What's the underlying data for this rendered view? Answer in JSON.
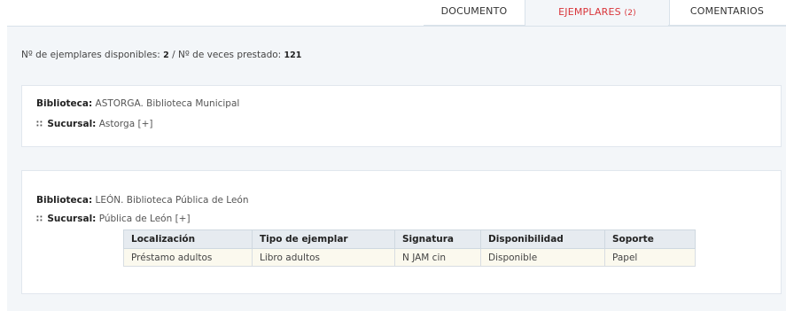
{
  "tabs": {
    "documento": "DOCUMENTO",
    "ejemplares": "EJEMPLARES",
    "ejemplares_count": "(2)",
    "comentarios": "COMENTARIOS"
  },
  "summary": {
    "disponibles_label": "Nº de ejemplares disponibles:",
    "disponibles_value": "2",
    "separator": "/",
    "prestado_label": "Nº de veces prestado:",
    "prestado_value": "121"
  },
  "libraries": [
    {
      "biblioteca_label": "Biblioteca:",
      "biblioteca_value": "ASTORGA. Biblioteca Municipal",
      "sucursal_label": "Sucursal:",
      "sucursal_value": "Astorga",
      "expand": "[+]"
    },
    {
      "biblioteca_label": "Biblioteca:",
      "biblioteca_value": "LEÓN. Biblioteca Pública de León",
      "sucursal_label": "Sucursal:",
      "sucursal_value": "Pública de León",
      "expand": "[+]",
      "table": {
        "headers": [
          "Localización",
          "Tipo de ejemplar",
          "Signatura",
          "Disponibilidad",
          "Soporte"
        ],
        "rows": [
          [
            "Préstamo adultos",
            "Libro adultos",
            "N JAM cin",
            "Disponible",
            "Papel"
          ]
        ]
      }
    }
  ],
  "colors": {
    "active_tab": "#d9353a",
    "panel_bg": "#f3f6f9"
  }
}
